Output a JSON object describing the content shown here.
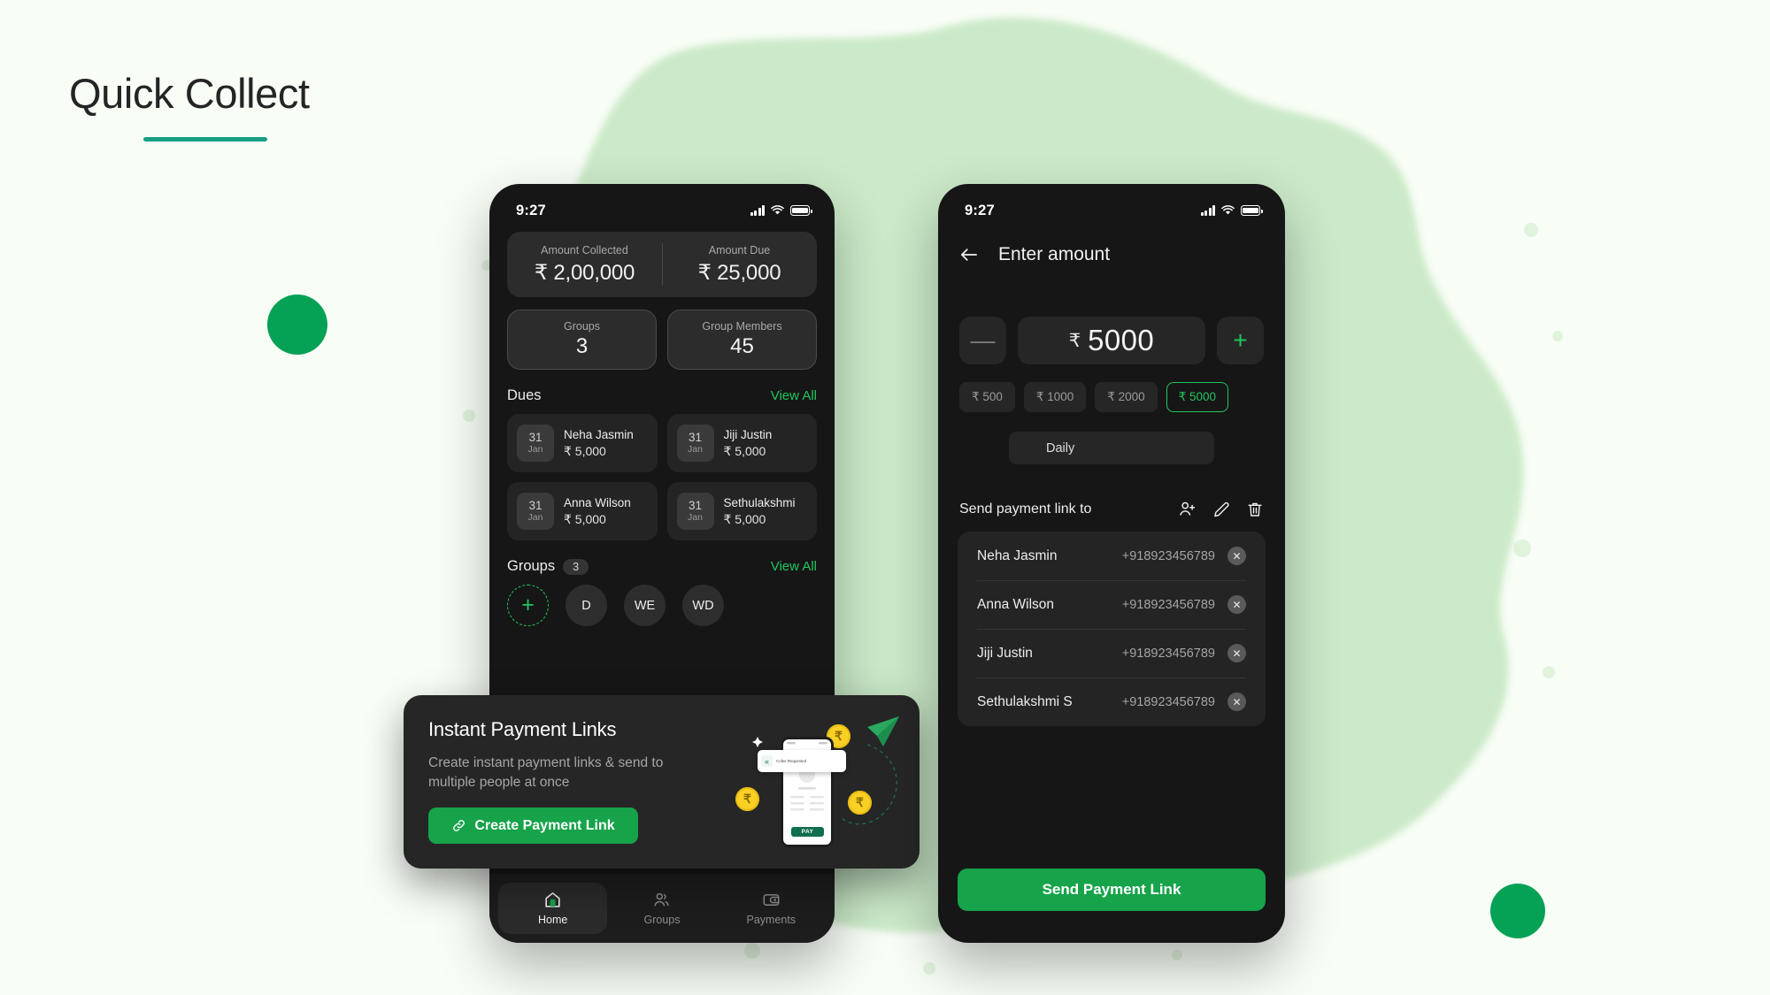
{
  "page": {
    "title": "Quick Collect",
    "background_color": "#f8fdf6",
    "accent_green": "#05a155",
    "underline_color": "#16a085"
  },
  "phone_home": {
    "status": {
      "time": "9:27"
    },
    "summary": {
      "collected_label": "Amount Collected",
      "collected_value": "₹ 2,00,000",
      "due_label": "Amount Due",
      "due_value": "₹ 25,000"
    },
    "stats": [
      {
        "label": "Groups",
        "value": "3"
      },
      {
        "label": "Group Members",
        "value": "45"
      }
    ],
    "dues_section": {
      "title": "Dues",
      "view_all": "View All"
    },
    "dues": [
      {
        "day": "31",
        "month": "Jan",
        "name": "Neha Jasmin",
        "amount": "₹ 5,000"
      },
      {
        "day": "31",
        "month": "Jan",
        "name": "Jiji Justin",
        "amount": "₹ 5,000"
      },
      {
        "day": "31",
        "month": "Jan",
        "name": "Anna Wilson",
        "amount": "₹ 5,000"
      },
      {
        "day": "31",
        "month": "Jan",
        "name": "Sethulakshmi",
        "amount": "₹ 5,000"
      }
    ],
    "groups_section": {
      "title": "Groups",
      "count": "3",
      "view_all": "View All"
    },
    "group_avatars": [
      {
        "initials": "+"
      },
      {
        "initials": "D"
      },
      {
        "initials": "WE"
      },
      {
        "initials": "WD"
      }
    ],
    "bottom_nav": [
      {
        "label": "Home",
        "icon": "home-icon",
        "active": true
      },
      {
        "label": "Groups",
        "icon": "people-icon",
        "active": false
      },
      {
        "label": "Payments",
        "icon": "wallet-icon",
        "active": false
      }
    ]
  },
  "promo": {
    "title": "Instant Payment Links",
    "subtitle": "Create instant payment links & send to multiple people at once",
    "button_label": "Create Payment Link",
    "button_color": "#16a34a",
    "art": {
      "toast_text": "Cofee Requested",
      "pay_label": "PAY",
      "coin_symbol": "₹"
    }
  },
  "phone_amount": {
    "status": {
      "time": "9:27"
    },
    "header": {
      "title": "Enter amount",
      "back_icon": "arrow-left-icon"
    },
    "stepper": {
      "minus_label": "—",
      "plus_label": "+",
      "currency": "₹",
      "value": "5000"
    },
    "quick_amounts": [
      {
        "label": "₹ 500",
        "selected": false
      },
      {
        "label": "₹ 1000",
        "selected": false
      },
      {
        "label": "₹ 2000",
        "selected": false
      },
      {
        "label": "₹ 5000",
        "selected": true
      }
    ],
    "frequency": {
      "value": "Daily"
    },
    "send_section": {
      "title": "Send payment link to",
      "actions": [
        {
          "icon": "add-person-icon"
        },
        {
          "icon": "edit-pencil-icon"
        },
        {
          "icon": "trash-icon"
        }
      ]
    },
    "contacts": [
      {
        "name": "Neha Jasmin",
        "phone": "+918923456789"
      },
      {
        "name": "Anna Wilson",
        "phone": "+918923456789"
      },
      {
        "name": "Jiji Justin",
        "phone": "+918923456789"
      },
      {
        "name": "Sethulakshmi S",
        "phone": "+918923456789"
      }
    ],
    "primary_button": {
      "label": "Send Payment Link",
      "color": "#16a34a"
    }
  }
}
